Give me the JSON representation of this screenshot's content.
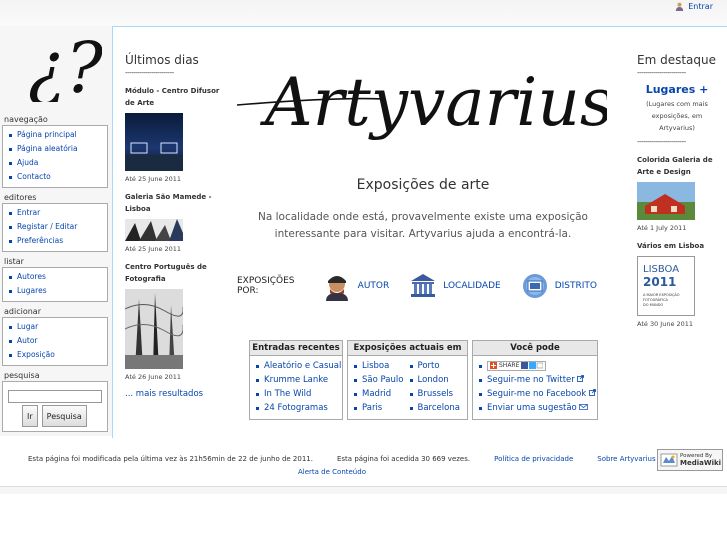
{
  "header": {
    "login_label": "Entrar"
  },
  "sidebar": {
    "logo_text": "¿?",
    "sections": [
      {
        "title": "navegação",
        "items": [
          "Página principal",
          "Página aleatória",
          "Ajuda",
          "Contacto"
        ]
      },
      {
        "title": "editores",
        "items": [
          "Entrar",
          "Registar / Editar",
          "Preferências"
        ]
      },
      {
        "title": "listar",
        "items": [
          "Autores",
          "Lugares"
        ]
      },
      {
        "title": "adicionar",
        "items": [
          "Lugar",
          "Autor",
          "Exposição"
        ]
      }
    ],
    "search": {
      "title": "pesquisa",
      "value": "",
      "go_label": "Ir",
      "search_label": "Pesquisa"
    }
  },
  "ultimos": {
    "heading": "Últimos dias",
    "dashes": "------------------------",
    "items": [
      {
        "title": "Módulo - Centro Difusor de Arte",
        "date": "Até 25 June 2011"
      },
      {
        "title": "Galeria São Mamede - Lisboa",
        "date": "Até 25 June 2011"
      },
      {
        "title": "Centro Português de Fotografia",
        "date": "Até 26 June 2011"
      }
    ],
    "more_link": "... mais resultados"
  },
  "center": {
    "brand": "Artyvarius",
    "subtitle": "Exposições de arte",
    "intro": "Na localidade onde está, provavelmente existe uma exposição interessante para visitar. Artyvarius ajuda a encontrá-la.",
    "by_label": "EXPOSIÇÕES POR:",
    "by_items": [
      {
        "label": "AUTOR",
        "icon": "author-icon"
      },
      {
        "label": "LOCALIDADE",
        "icon": "building-icon"
      },
      {
        "label": "DISTRITO",
        "icon": "district-icon"
      }
    ]
  },
  "tables": {
    "recentes": {
      "title": "Entradas recentes",
      "items": [
        "Aleatório e Casual",
        "Krumme Lanke",
        "In The Wild",
        "24 Fotogramas"
      ]
    },
    "actuais": {
      "title": "Exposições actuais em",
      "col1": [
        "Lisboa",
        "São Paulo",
        "Madrid",
        "Paris"
      ],
      "col2": [
        "Porto",
        "London",
        "Brussels",
        "Barcelona"
      ]
    },
    "voce": {
      "title": "Você pode",
      "share_label": "SHARE",
      "items": [
        "Seguir-me no Twitter",
        "Seguir-me no Facebook",
        "Enviar uma sugestão"
      ]
    }
  },
  "destaque": {
    "heading": "Em destaque",
    "dashes": "------------------------",
    "lugares": "Lugares +",
    "lugares_desc": "(Lugares com mais exposições, em Artyvarius)",
    "dashes2": "------------------------",
    "items": [
      {
        "title": "Colorida Galeria de Arte e Design",
        "date": "Até 1 July 2011"
      },
      {
        "title": "Vários em Lisboa",
        "date": "Até 30 June 2011",
        "poster_lines": [
          "LISBOA",
          "2011",
          "A MAIOR EXPOSIÇÃO",
          "FOTOGRÁFICA",
          "DO MUNDO"
        ]
      }
    ]
  },
  "footer": {
    "modified": "Esta página foi modificada pela última vez às 21h56min de 22 de junho de 2011.",
    "accessed": "Esta página foi acedida 30 669 vezes.",
    "privacy": "Política de privacidade",
    "about": "Sobre Artyvarius",
    "alert": "Alerta de Conteúdo",
    "badge_small": "Powered By",
    "badge_big": "MediaWiki"
  }
}
